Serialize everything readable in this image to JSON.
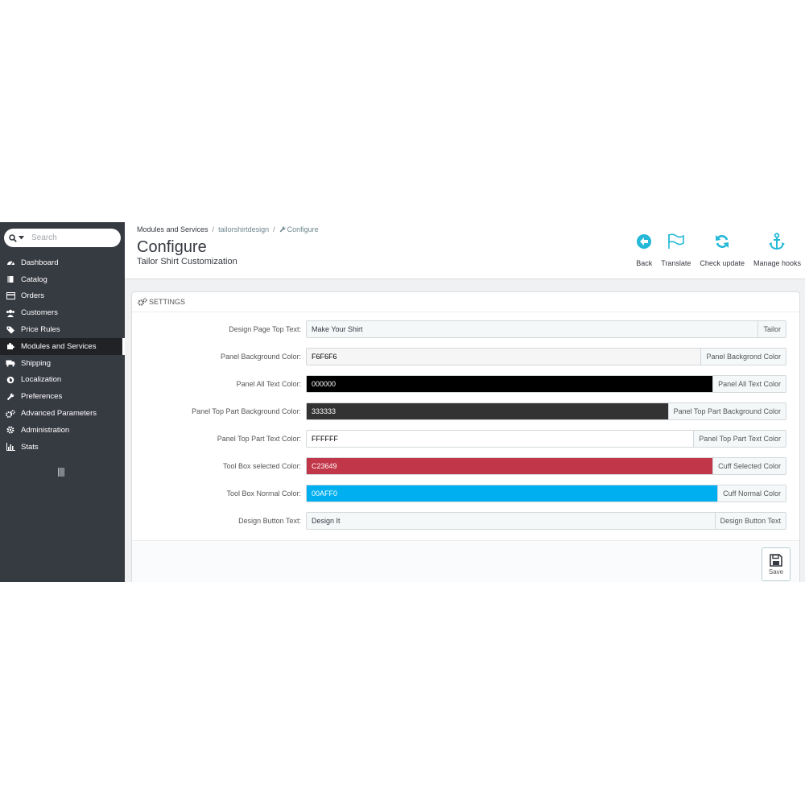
{
  "sidebar": {
    "search_placeholder": "Search",
    "items": [
      {
        "label": "Dashboard",
        "icon": "dashboard-icon"
      },
      {
        "label": "Catalog",
        "icon": "book-icon"
      },
      {
        "label": "Orders",
        "icon": "credit-card-icon"
      },
      {
        "label": "Customers",
        "icon": "users-icon"
      },
      {
        "label": "Price Rules",
        "icon": "tags-icon"
      },
      {
        "label": "Modules and Services",
        "icon": "puzzle-icon",
        "active": true
      },
      {
        "label": "Shipping",
        "icon": "truck-icon"
      },
      {
        "label": "Localization",
        "icon": "globe-icon"
      },
      {
        "label": "Preferences",
        "icon": "wrench-icon"
      },
      {
        "label": "Advanced Parameters",
        "icon": "cogs-icon"
      },
      {
        "label": "Administration",
        "icon": "gear-icon"
      },
      {
        "label": "Stats",
        "icon": "bar-chart-icon"
      }
    ]
  },
  "header": {
    "breadcrumb": {
      "root": "Modules and Services",
      "module": "tailorshirtdesign",
      "current": "Configure"
    },
    "title": "Configure",
    "subtitle": "Tailor Shirt Customization",
    "toolbar": [
      {
        "label": "Back",
        "icon": "back-arrow-icon"
      },
      {
        "label": "Translate",
        "icon": "flag-icon"
      },
      {
        "label": "Check update",
        "icon": "refresh-icon"
      },
      {
        "label": "Manage hooks",
        "icon": "anchor-icon"
      }
    ]
  },
  "panel": {
    "heading": "Settings",
    "fields": [
      {
        "label": "Design Page Top Text:",
        "value": "Make Your Shirt",
        "addon": "Tailor",
        "bg": "#F5F8F9",
        "fg": "#363A41"
      },
      {
        "label": "Panel Background Color:",
        "value": "F6F6F6",
        "addon": "Panel Backgrond Color",
        "bg": "#F6F6F6",
        "fg": "#000000"
      },
      {
        "label": "Panel All Text Color:",
        "value": "000000",
        "addon": "Panel All Text Color",
        "bg": "#000000",
        "fg": "#FFFFFF"
      },
      {
        "label": "Panel Top Part Background Color:",
        "value": "333333",
        "addon": "Panel Top Part Background Color",
        "bg": "#333333",
        "fg": "#FFFFFF"
      },
      {
        "label": "Panel Top Part Text Color:",
        "value": "FFFFFF",
        "addon": "Panel Top Part Text Color",
        "bg": "#FFFFFF",
        "fg": "#000000"
      },
      {
        "label": "Tool Box selected Color:",
        "value": "C23649",
        "addon": "Cuff Selected Color",
        "bg": "#C23649",
        "fg": "#FFFFFF"
      },
      {
        "label": "Tool Box Normal Color:",
        "value": "00AFF0",
        "addon": "Cuff Normal Color",
        "bg": "#00AFF0",
        "fg": "#FFFFFF"
      },
      {
        "label": "Design Button Text:",
        "value": "Design It",
        "addon": "Design Button Text",
        "bg": "#F5F8F9",
        "fg": "#363A41"
      }
    ],
    "save_label": "Save"
  },
  "colors": {
    "sidebar_bg": "#363A41",
    "accent": "#25B9D7",
    "page_bg": "#EFF1F2"
  }
}
